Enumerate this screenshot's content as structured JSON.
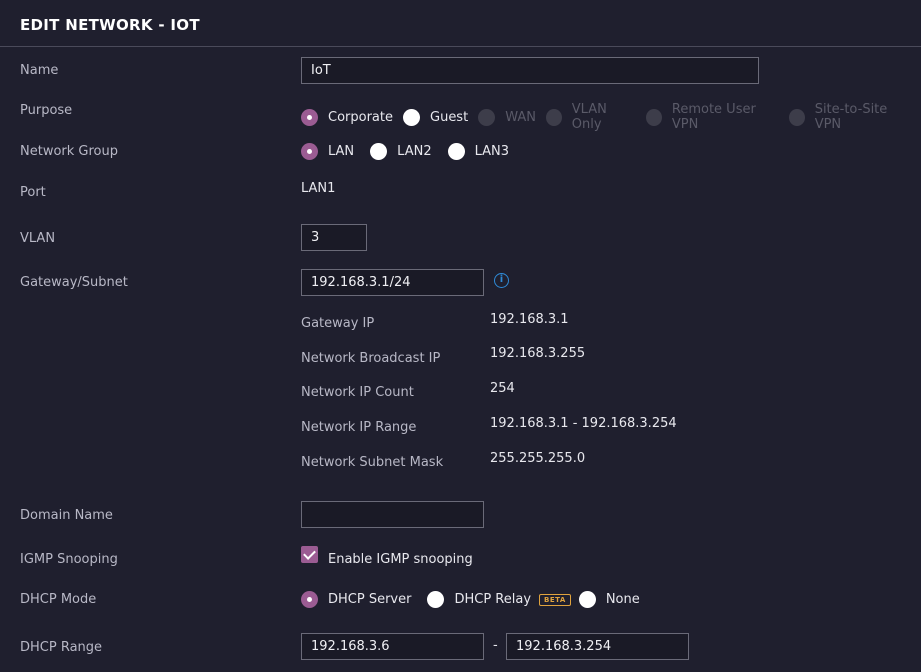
{
  "header": {
    "title": "EDIT NETWORK - IOT"
  },
  "labels": {
    "name": "Name",
    "purpose": "Purpose",
    "network_group": "Network Group",
    "port": "Port",
    "vlan": "VLAN",
    "gateway_subnet": "Gateway/Subnet",
    "domain_name": "Domain Name",
    "igmp_snooping": "IGMP Snooping",
    "dhcp_mode": "DHCP Mode",
    "dhcp_range": "DHCP Range"
  },
  "fields": {
    "name_value": "IoT",
    "port_value": "LAN1",
    "vlan_value": "3",
    "gateway_subnet_value": "192.168.3.1/24",
    "domain_name_value": "",
    "dhcp_range_start": "192.168.3.6",
    "dhcp_range_sep": "-",
    "dhcp_range_end": "192.168.3.254"
  },
  "purpose_options": {
    "corporate": "Corporate",
    "guest": "Guest",
    "wan": "WAN",
    "vlan_only": "VLAN Only",
    "remote_user_vpn": "Remote User VPN",
    "site_to_site_vpn": "Site-to-Site VPN",
    "selected": "Corporate"
  },
  "network_group_options": {
    "lan": "LAN",
    "lan2": "LAN2",
    "lan3": "LAN3",
    "selected": "LAN"
  },
  "subnet_info": {
    "gateway_ip_label": "Gateway IP",
    "gateway_ip": "192.168.3.1",
    "broadcast_label": "Network Broadcast IP",
    "broadcast": "192.168.3.255",
    "ip_count_label": "Network IP Count",
    "ip_count": "254",
    "ip_range_label": "Network IP Range",
    "ip_range": "192.168.3.1 - 192.168.3.254",
    "subnet_mask_label": "Network Subnet Mask",
    "subnet_mask": "255.255.255.0"
  },
  "igmp": {
    "checkbox_label": "Enable IGMP snooping",
    "checked": true
  },
  "dhcp_mode_options": {
    "server": "DHCP Server",
    "relay": "DHCP Relay",
    "relay_badge": "BETA",
    "none": "None",
    "selected": "DHCP Server"
  },
  "icons": {
    "info": "i"
  },
  "colors": {
    "accent": "#9b5c93",
    "info": "#2f8bd8",
    "badge": "#e0a33e",
    "background": "#1f1f2e"
  }
}
